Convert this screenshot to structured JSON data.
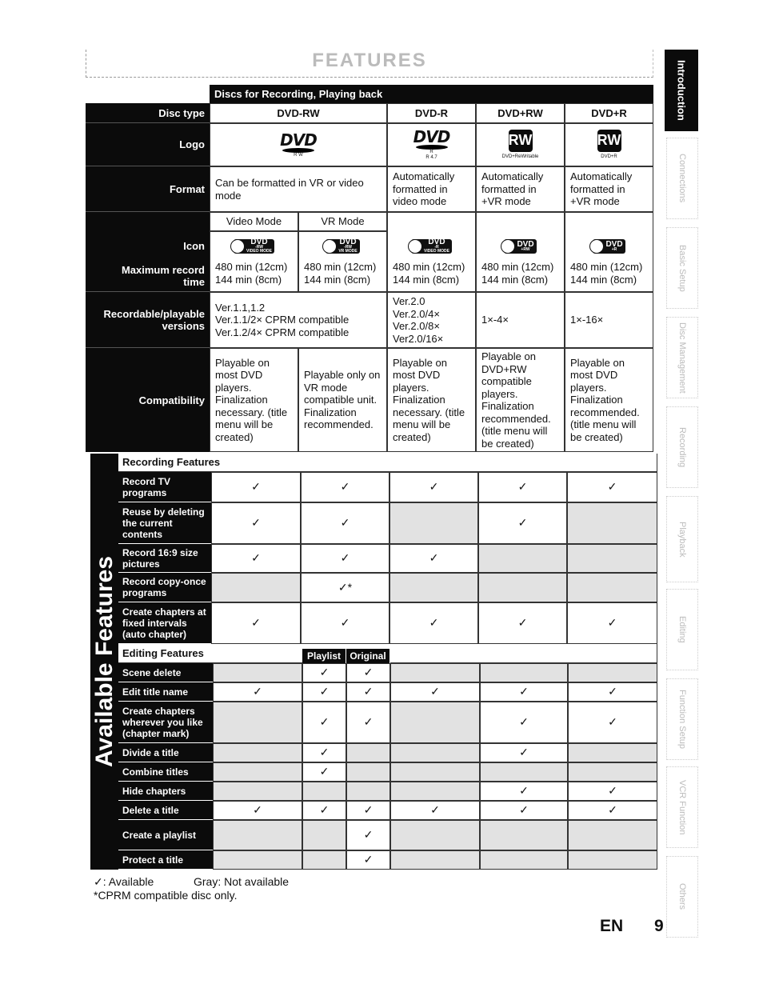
{
  "page": {
    "title": "FEATURES",
    "lang": "EN",
    "page_number": "9"
  },
  "side_tabs": [
    {
      "label": "Introduction",
      "active": true
    },
    {
      "label": "Connections",
      "active": false
    },
    {
      "label": "Basic Setup",
      "active": false
    },
    {
      "label": "Disc Management",
      "active": false
    },
    {
      "label": "Recording",
      "active": false
    },
    {
      "label": "Playback",
      "active": false
    },
    {
      "label": "Editing",
      "active": false
    },
    {
      "label": "Function Setup",
      "active": false
    },
    {
      "label": "VCR Function",
      "active": false
    },
    {
      "label": "Others",
      "active": false
    }
  ],
  "table": {
    "group_header": "Discs for Recording, Playing back",
    "row_labels": {
      "disc_type": "Disc type",
      "logo": "Logo",
      "format": "Format",
      "icon": "Icon",
      "max_time": "Maximum record time",
      "versions": "Recordable/playable versions",
      "compat": "Compatibility"
    },
    "discs": [
      "DVD-RW",
      "DVD-R",
      "DVD+RW",
      "DVD+R"
    ],
    "logos": [
      {
        "mark": "DVD",
        "caption": "R W"
      },
      {
        "mark": "DVD",
        "caption": "R\nR 4.7"
      },
      {
        "mark": "RW",
        "caption": "DVD+ReWritable"
      },
      {
        "mark": "RW",
        "caption": "DVD+R"
      }
    ],
    "format": [
      "Can be formatted in VR or video mode",
      "Automatically formatted in video mode",
      "Automatically formatted in +VR mode",
      "Automatically formatted in +VR mode"
    ],
    "modes": [
      "Video Mode",
      "VR Mode"
    ],
    "icons": [
      {
        "name": "DVD",
        "sub": "-RW",
        "mode": "VIDEO MODE"
      },
      {
        "name": "DVD",
        "sub": "-RW",
        "mode": "VR MODE"
      },
      {
        "name": "DVD",
        "sub": "-R",
        "mode": "VIDEO MODE"
      },
      {
        "name": "DVD",
        "sub": "+RW",
        "mode": ""
      },
      {
        "name": "DVD",
        "sub": "+R",
        "mode": ""
      }
    ],
    "max_time": [
      "480 min (12cm) 144 min (8cm)",
      "480 min (12cm) 144 min (8cm)",
      "480 min (12cm) 144 min (8cm)",
      "480 min (12cm) 144 min (8cm)",
      "480 min (12cm) 144 min (8cm)"
    ],
    "versions": [
      "Ver.1.1,1.2\nVer.1.1/2× CPRM compatible\nVer.1.2/4× CPRM compatible",
      "Ver.2.0\nVer.2.0/4×\nVer.2.0/8×\nVer2.0/16×",
      "1×-4×",
      "1×-16×"
    ],
    "compat": [
      "Playable on most DVD players. Finalization necessary. (title menu will be created)",
      "Playable only on VR mode compatible unit. Finalization recommended.",
      "Playable on most DVD players. Finalization necessary. (title menu will be created)",
      "Playable on DVD+RW compatible players. Finalization recommended. (title menu will be created)",
      "Playable on most DVD players. Finalization recommended. (title menu will be created)"
    ]
  },
  "features": {
    "band_label": "Available Features",
    "recording_header": "Recording Features",
    "recording": [
      {
        "label": "Record TV programs",
        "values": [
          "✓",
          "✓",
          "✓",
          "✓",
          "✓"
        ]
      },
      {
        "label": "Reuse by deleting the current contents",
        "values": [
          "✓",
          "✓",
          "",
          "✓",
          ""
        ]
      },
      {
        "label": "Record 16:9 size pictures",
        "values": [
          "✓",
          "✓",
          "✓",
          "",
          ""
        ]
      },
      {
        "label": "Record copy-once programs",
        "values": [
          "",
          "✓*",
          "",
          "",
          ""
        ]
      },
      {
        "label": "Create chapters at fixed intervals (auto chapter)",
        "values": [
          "✓",
          "✓",
          "✓",
          "✓",
          "✓"
        ]
      }
    ],
    "editing_header": "Editing Features",
    "vr_sub": [
      "Playlist",
      "Original"
    ],
    "editing": [
      {
        "label": "Scene delete",
        "values": [
          "",
          "✓",
          "✓",
          "",
          "",
          ""
        ]
      },
      {
        "label": "Edit title name",
        "values": [
          "✓",
          "✓",
          "✓",
          "✓",
          "✓",
          "✓"
        ]
      },
      {
        "label": "Create chapters wherever you like (chapter mark)",
        "values": [
          "",
          "✓",
          "✓",
          "",
          "✓",
          "✓"
        ]
      },
      {
        "label": "Divide a title",
        "values": [
          "",
          "✓",
          "",
          "",
          "✓",
          ""
        ]
      },
      {
        "label": "Combine titles",
        "values": [
          "",
          "✓",
          "",
          "",
          "",
          ""
        ]
      },
      {
        "label": "Hide chapters",
        "values": [
          "",
          "",
          "",
          "",
          "✓",
          "✓"
        ]
      },
      {
        "label": "Delete a title",
        "values": [
          "✓",
          "✓",
          "✓",
          "✓",
          "✓",
          "✓"
        ]
      },
      {
        "label": "Create a playlist",
        "values": [
          "",
          "",
          "✓",
          "",
          "",
          ""
        ]
      },
      {
        "label": "Protect a title",
        "values": [
          "",
          "",
          "✓",
          "",
          "",
          ""
        ]
      }
    ]
  },
  "legend": {
    "available": "✓: Available",
    "gray": "Gray: Not available",
    "note": "*CPRM compatible disc only."
  }
}
